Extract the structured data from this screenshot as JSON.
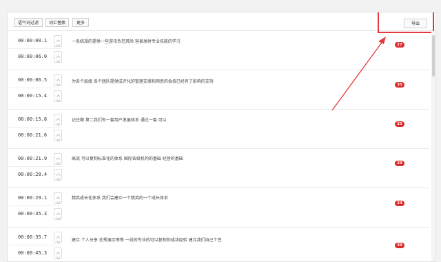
{
  "toolbar": {
    "buttons": [
      "语气词过滤",
      "词汇替换",
      "更多"
    ],
    "export_label": "导出"
  },
  "rows": [
    {
      "start": "00:00:00.1",
      "end": "00:00:06.0",
      "text": "一系统规的提供一些游讯负范风险 容易发射专业技能的学习",
      "count": "27"
    },
    {
      "start": "00:00:06.5",
      "end": "00:00:15.4",
      "text": "为各个层级 各个团队提供成评化的管理支撑和网意的会佰已经有了影响的支持",
      "count": "35"
    },
    {
      "start": "00:00:15.8",
      "end": "00:00:21.6",
      "text": "记住啊 第二我们有一套用户发展体系 通过一套 可以",
      "count": "25"
    },
    {
      "start": "00:00:21.9",
      "end": "00:00:28.4",
      "text": "高效 可以复制标准化的体系 国际各级机构的基础 经营的基础",
      "count": "29"
    },
    {
      "start": "00:00:29.1",
      "end": "00:00:35.3",
      "text": "精英成长化体系 我们会建立一个精英的一个成长体系",
      "count": "24"
    },
    {
      "start": "00:00:35.7",
      "end": "00:00:45.3",
      "text": "建立 个人分享 优秀展示等等 一线的专业的可以复制的成功经验 建立我们自己个性",
      "count": "39"
    }
  ],
  "colors": {
    "accent": "#e02a2a",
    "annotation": "#e23a3a"
  }
}
